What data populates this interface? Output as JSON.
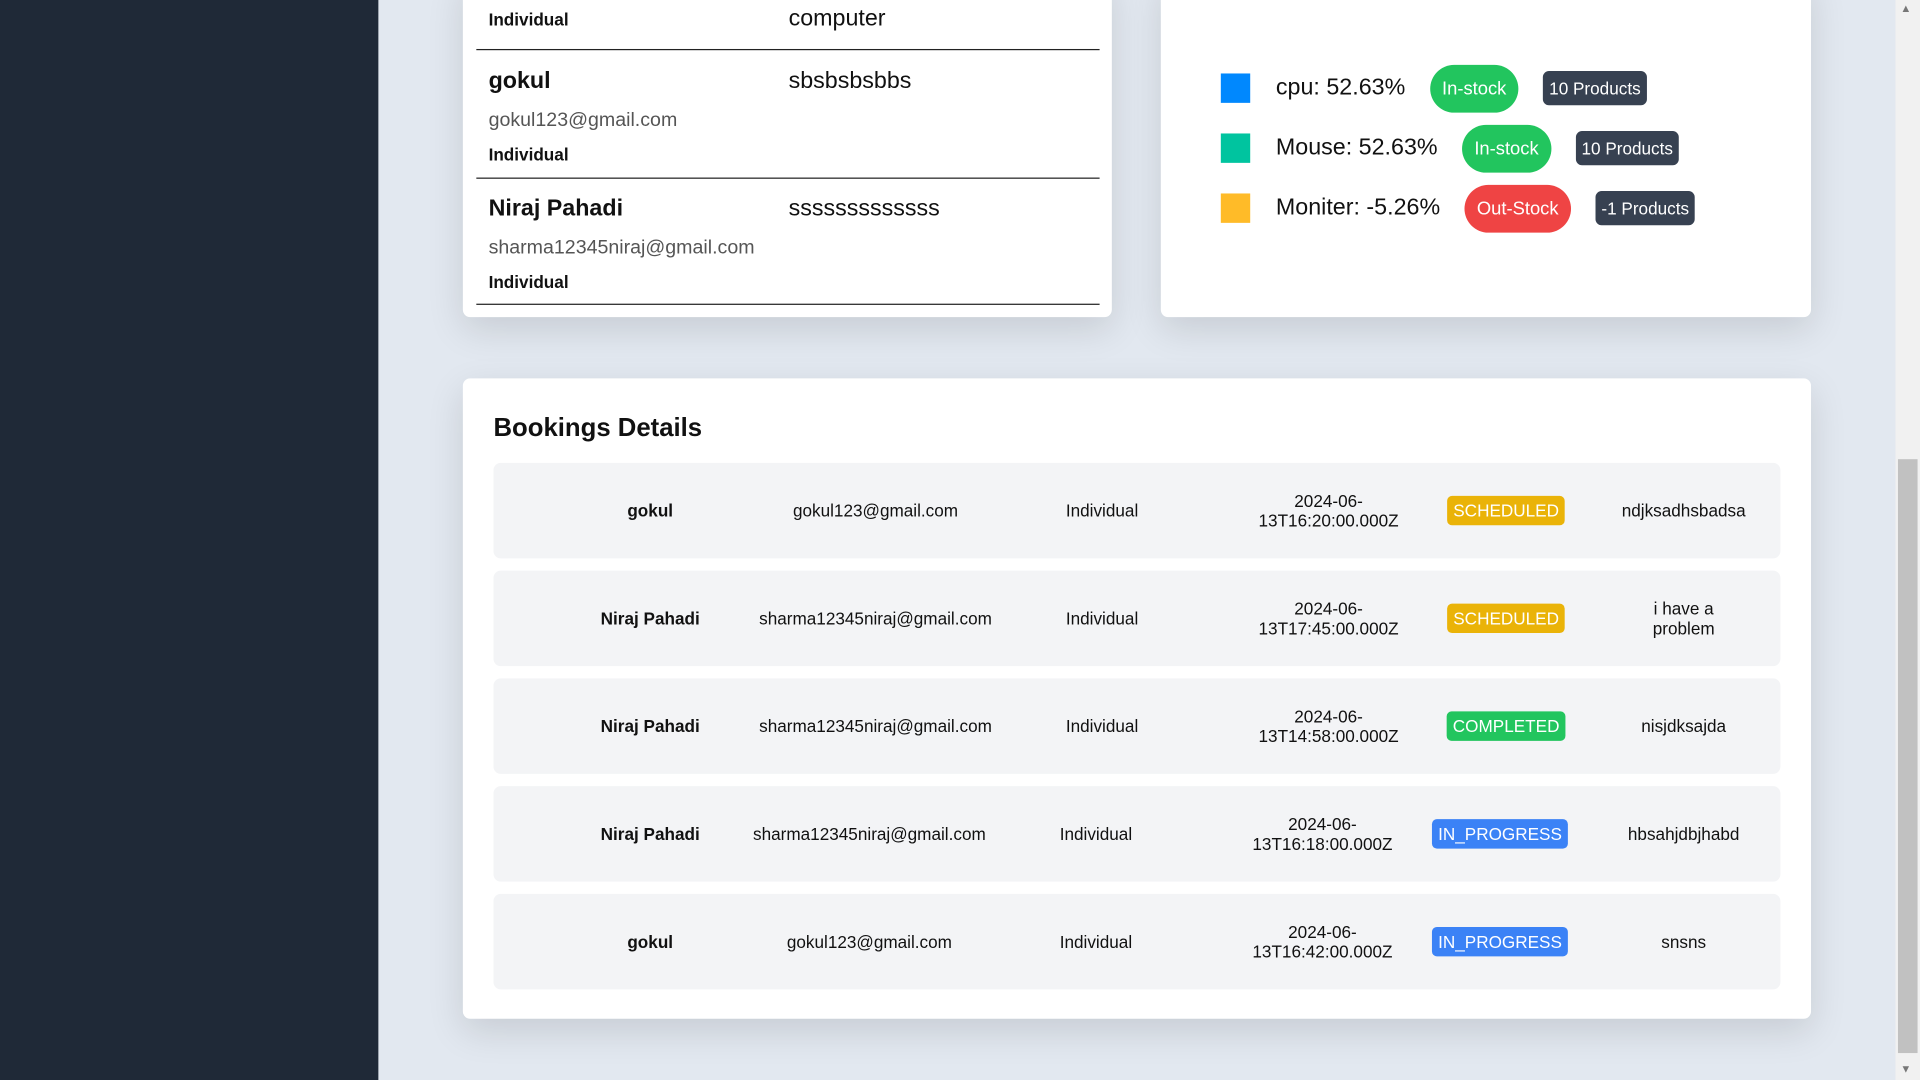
{
  "users": [
    {
      "name": "",
      "email": "",
      "type": "Individual",
      "desc": "computer"
    },
    {
      "name": "gokul",
      "email": "gokul123@gmail.com",
      "type": "Individual",
      "desc": "sbsbsbsbbs"
    },
    {
      "name": "Niraj Pahadi",
      "email": "sharma12345niraj@gmail.com",
      "type": "Individual",
      "desc": "sssssssssssss"
    }
  ],
  "stock": [
    {
      "label": "cpu: 52.63%",
      "color": "#0088fe",
      "status": "In-stock",
      "status_color": "#22c55e",
      "count": "10 Products"
    },
    {
      "label": "Mouse: 52.63%",
      "color": "#00c49f",
      "status": "In-stock",
      "status_color": "#22c55e",
      "count": "10 Products"
    },
    {
      "label": "Moniter: -5.26%",
      "color": "#ffbb28",
      "status": "Out-Stock",
      "status_color": "#ef4444",
      "count": "-1 Products"
    }
  ],
  "bookings": {
    "title": "Bookings Details",
    "rows": [
      {
        "name": "gokul",
        "email": "gokul123@gmail.com",
        "type": "Individual",
        "date": "2024-06-13T16:20:00.000Z",
        "status": "SCHEDULED",
        "status_color": "#eab308",
        "note": "ndjksadhsbadsa"
      },
      {
        "name": "Niraj Pahadi",
        "email": "sharma12345niraj@gmail.com",
        "type": "Individual",
        "date": "2024-06-13T17:45:00.000Z",
        "status": "SCHEDULED",
        "status_color": "#eab308",
        "note": "i have a problem"
      },
      {
        "name": "Niraj Pahadi",
        "email": "sharma12345niraj@gmail.com",
        "type": "Individual",
        "date": "2024-06-13T14:58:00.000Z",
        "status": "COMPLETED",
        "status_color": "#22c55e",
        "note": "nisjdksajda"
      },
      {
        "name": "Niraj Pahadi",
        "email": "sharma12345niraj@gmail.com",
        "type": "Individual",
        "date": "2024-06-13T16:18:00.000Z",
        "status": "IN_PROGRESS",
        "status_color": "#3b82f6",
        "note": "hbsahjdbjhabd"
      },
      {
        "name": "gokul",
        "email": "gokul123@gmail.com",
        "type": "Individual",
        "date": "2024-06-13T16:42:00.000Z",
        "status": "IN_PROGRESS",
        "status_color": "#3b82f6",
        "note": "snsns"
      }
    ]
  }
}
